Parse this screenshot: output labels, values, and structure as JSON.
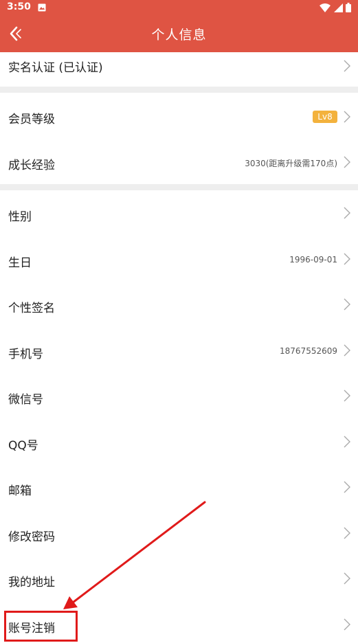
{
  "status_bar": {
    "time": "3:50"
  },
  "header": {
    "title": "个人信息"
  },
  "rows": [
    {
      "label": "实名认证 (已认证)"
    },
    {
      "label": "会员等级",
      "badge": "Lv8"
    },
    {
      "label": "成长经验",
      "value": "3030(距离升级需170点)"
    },
    {
      "label": "性别"
    },
    {
      "label": "生日",
      "value": "1996-09-01"
    },
    {
      "label": "个性签名"
    },
    {
      "label": "手机号",
      "value": "18767552609"
    },
    {
      "label": "微信号"
    },
    {
      "label": "QQ号"
    },
    {
      "label": "邮箱"
    },
    {
      "label": "修改密码"
    },
    {
      "label": "我的地址"
    },
    {
      "label": "账号注销"
    }
  ],
  "colors": {
    "header": "#df5443",
    "badge": "#f3b23d",
    "annotation": "#e01a1a",
    "divider": "#eeeeee"
  },
  "icons": [
    "image-icon",
    "wifi-icon",
    "signal-icon",
    "battery-icon",
    "back-arrow-icon",
    "chevron-right-icon"
  ]
}
